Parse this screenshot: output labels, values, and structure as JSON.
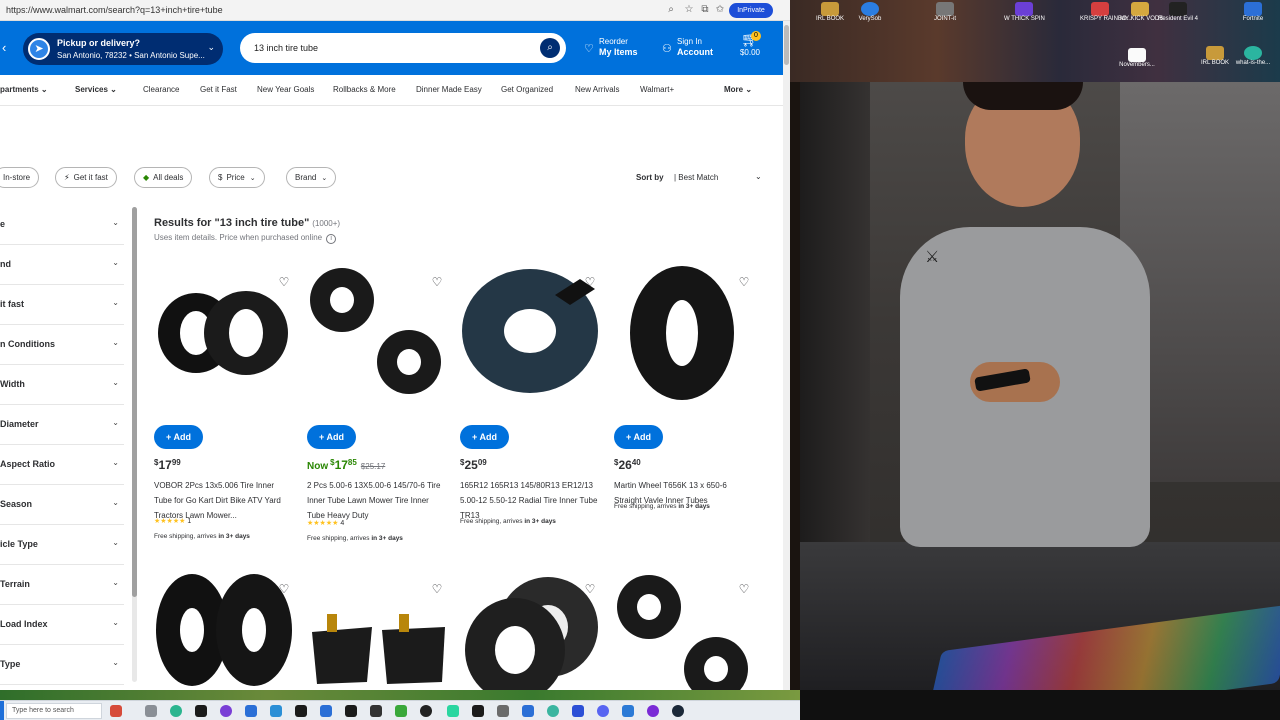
{
  "browser": {
    "url": "https://www.walmart.com/search?q=13+inch+tire+tube",
    "inprivate_label": "InPrivate"
  },
  "header": {
    "pickup_title": "Pickup or delivery?",
    "pickup_location": "San Antonio, 78232 • San Antonio Supe...",
    "search_value": "13 inch tire tube",
    "reorder_line1": "Reorder",
    "reorder_line2": "My Items",
    "signin_line1": "Sign In",
    "signin_line2": "Account",
    "cart_count": "0",
    "cart_total": "$0.00"
  },
  "nav": {
    "departments": "partments",
    "services": "Services",
    "items": [
      "Clearance",
      "Get it Fast",
      "New Year Goals",
      "Rollbacks & More",
      "Dinner Made Easy",
      "Get Organized",
      "New Arrivals",
      "Walmart+"
    ],
    "more": "More"
  },
  "filters": {
    "pills": [
      "In-store",
      "Get it fast",
      "All deals",
      "Price",
      "Brand"
    ],
    "sort_label": "Sort by",
    "sort_value": "| Best Match"
  },
  "sidebar": {
    "items": [
      "e",
      "nd",
      "it fast",
      "n Conditions",
      "Width",
      "Diameter",
      "Aspect Ratio",
      "Season",
      "icle Type",
      "Terrain",
      "Load Index",
      "Type"
    ]
  },
  "results": {
    "title": "Results for \"13 inch tire tube\"",
    "count": "(1000+)",
    "subtitle": "Uses item details. Price when purchased online"
  },
  "products": [
    {
      "add_label": "Add",
      "price_prefix": "",
      "price_dollars": "17",
      "price_cents": "99",
      "was_price": "",
      "title": "VOBOR 2Pcs 13x5.006 Tire Inner Tube for Go Kart Dirt Bike ATV Yard Tractors Lawn Mower...",
      "rating_count": "1",
      "shipping_prefix": "Free shipping, arrives ",
      "shipping_days": "in 3+ days"
    },
    {
      "add_label": "Add",
      "price_prefix": "Now",
      "price_dollars": "17",
      "price_cents": "85",
      "was_price": "$25.17",
      "title": "2 Pcs 5.00-6 13X5.00-6 145/70-6 Tire Inner Tube Lawn Mower Tire Inner Tube Heavy Duty",
      "rating_count": "4",
      "shipping_prefix": "Free shipping, arrives ",
      "shipping_days": "in 3+ days"
    },
    {
      "add_label": "Add",
      "price_prefix": "",
      "price_dollars": "25",
      "price_cents": "09",
      "was_price": "",
      "title": "165R12 165R13 145/80R13 ER12/13 5.00-12 5.50-12 Radial Tire Inner Tube TR13",
      "rating_count": "",
      "shipping_prefix": "Free shipping, arrives ",
      "shipping_days": "in 3+ days"
    },
    {
      "add_label": "Add",
      "price_prefix": "",
      "price_dollars": "26",
      "price_cents": "40",
      "was_price": "",
      "title": "Martin Wheel T656K 13 x 650-6 Straight Vavle Inner Tubes",
      "rating_count": "",
      "shipping_prefix": "Free shipping, arrives ",
      "shipping_days": "in 3+ days"
    }
  ],
  "desktop": {
    "icons": [
      "IRL BOOK",
      "VerySob",
      "JOINT-it",
      "W THICK SPIN",
      "KRISPY RAINBO...",
      "MY KICK VODS",
      "Resident Evil 4",
      "Fortnite",
      "Novembers...",
      "IRL BOOK",
      "what-is-the..."
    ]
  },
  "taskbar": {
    "search_placeholder": "Type here to search"
  },
  "colors": {
    "walmart_blue": "#0071dc",
    "walmart_dark_blue": "#002d72",
    "walmart_yellow": "#ffc220",
    "deal_green": "#2a8703"
  }
}
